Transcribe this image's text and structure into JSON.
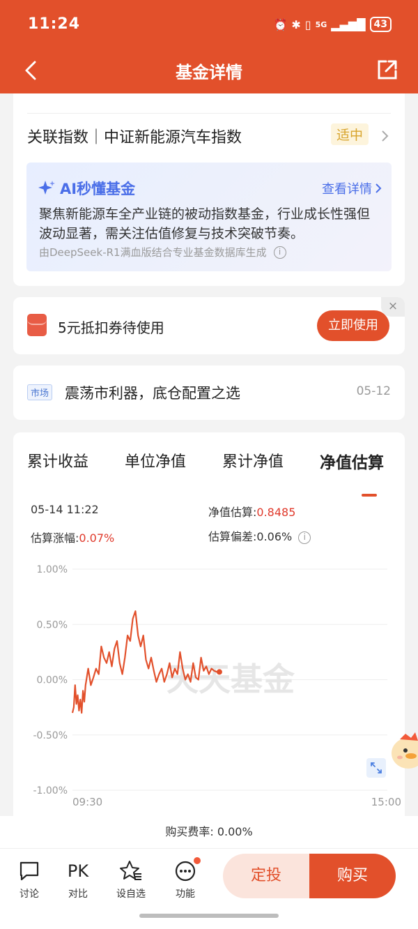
{
  "status_bar": {
    "time": "11:24",
    "network": "5G",
    "battery": "43"
  },
  "nav": {
    "title": "基金详情"
  },
  "index": {
    "label": "关联指数｜中证新能源汽车指数",
    "badge": "适中"
  },
  "ai": {
    "title": "AI秒懂基金",
    "link": "查看详情",
    "text": "聚焦新能源车全产业链的被动指数基金，行业成长性强但波动显著，需关注估值修复与技术突破节奏。",
    "note": "由DeepSeek-R1满血版结合专业基金数据库生成"
  },
  "coupon": {
    "text": "5元抵扣券待使用",
    "button": "立即使用",
    "close": "×"
  },
  "market": {
    "tag": "市场",
    "text": "震荡市利器，底仓配置之选",
    "date": "05-12"
  },
  "tabs": [
    "累计收益",
    "单位净值",
    "累计净值",
    "净值估算"
  ],
  "estimate": {
    "datetime": "05-14 11:22",
    "nav_label": "净值估算:",
    "nav_value": "0.8485",
    "change_label": "估算涨幅:",
    "change_value": "0.07%",
    "deviation_label": "估算偏差:",
    "deviation_value": "0.06%"
  },
  "watermark": "天天基金",
  "chart_data": {
    "type": "line",
    "title": "",
    "xlabel": "",
    "ylabel": "",
    "x_ticks": [
      "09:30",
      "15:00"
    ],
    "y_ticks": [
      "1.00%",
      "0.50%",
      "0.00%",
      "-0.50%",
      "-1.00%"
    ],
    "ylim": [
      -1.0,
      1.0
    ],
    "x_range": [
      "09:30",
      "15:00"
    ],
    "grid": true,
    "color": "#e2502b",
    "series": [
      {
        "name": "",
        "x": [
          "09:30",
          "09:31",
          "09:32",
          "09:33",
          "09:34",
          "09:35",
          "09:36",
          "09:37",
          "09:38",
          "09:39",
          "09:40",
          "09:42",
          "09:44",
          "09:46",
          "09:48",
          "09:50",
          "09:52",
          "09:54",
          "09:56",
          "09:58",
          "10:00",
          "10:02",
          "10:04",
          "10:06",
          "10:08",
          "10:10",
          "10:12",
          "10:14",
          "10:16",
          "10:18",
          "10:20",
          "10:22",
          "10:24",
          "10:26",
          "10:28",
          "10:30",
          "10:32",
          "10:34",
          "10:36",
          "10:38",
          "10:40",
          "10:42",
          "10:44",
          "10:46",
          "10:48",
          "10:50",
          "10:52",
          "10:54",
          "10:56",
          "10:58",
          "11:00",
          "11:02",
          "11:04",
          "11:06",
          "11:08",
          "11:10",
          "11:12",
          "11:14",
          "11:16",
          "11:18",
          "11:20",
          "11:22"
        ],
        "values": [
          -0.3,
          -0.25,
          -0.05,
          -0.22,
          -0.14,
          -0.28,
          -0.18,
          -0.3,
          -0.1,
          -0.2,
          -0.05,
          0.1,
          -0.05,
          0.02,
          0.1,
          0.05,
          0.3,
          0.2,
          0.15,
          0.25,
          0.12,
          0.28,
          0.35,
          0.15,
          0.05,
          0.2,
          0.4,
          0.35,
          0.55,
          0.62,
          0.4,
          0.3,
          0.4,
          0.18,
          0.1,
          0.2,
          0.08,
          -0.02,
          0.05,
          0.1,
          -0.02,
          0.05,
          0.15,
          0.02,
          0.1,
          0.05,
          0.25,
          0.1,
          0.0,
          0.05,
          -0.02,
          0.15,
          0.02,
          0.0,
          0.2,
          0.08,
          0.12,
          0.05,
          0.1,
          0.08,
          0.07,
          0.07
        ]
      }
    ]
  },
  "fee": {
    "label": "购买费率: 0.00%"
  },
  "bottom": {
    "actions": [
      {
        "icon": "chat-icon",
        "label": "讨论"
      },
      {
        "icon": "pk-icon",
        "text": "PK",
        "label": "对比"
      },
      {
        "icon": "star-icon",
        "label": "设自选"
      },
      {
        "icon": "more-icon",
        "label": "功能"
      }
    ],
    "dingtou": "定投",
    "buy": "购买"
  }
}
